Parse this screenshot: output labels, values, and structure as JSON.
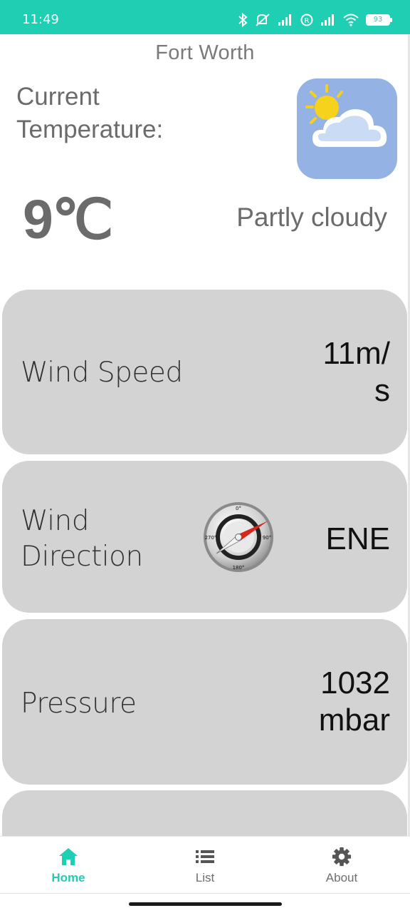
{
  "status_bar": {
    "time": "11:49",
    "battery": "93",
    "icons": [
      "bluetooth-icon",
      "mute-vibrate-icon",
      "signal-icon",
      "roaming-icon",
      "signal-icon",
      "wifi-icon",
      "battery-icon"
    ]
  },
  "header": {
    "city": "Fort Worth"
  },
  "current": {
    "label": "Current Temperature:",
    "temperature": "9℃",
    "condition": "Partly cloudy",
    "icon": "partly-cloudy-icon"
  },
  "cards": {
    "wind_speed": {
      "label": "Wind Speed",
      "value_line1": "11m/",
      "value_line2": "s"
    },
    "wind_direction": {
      "label_line1": "Wind",
      "label_line2": "Direction",
      "value": "ENE",
      "icon": "compass-icon",
      "compass_marks": [
        "0°",
        "90°",
        "180°",
        "270°"
      ]
    },
    "pressure": {
      "label": "Pressure",
      "value_line1": "1032",
      "value_line2": "mbar"
    }
  },
  "nav": {
    "items": [
      {
        "label": "Home",
        "icon": "home-icon",
        "active": true
      },
      {
        "label": "List",
        "icon": "list-icon",
        "active": false
      },
      {
        "label": "About",
        "icon": "gear-icon",
        "active": false
      }
    ]
  },
  "colors": {
    "accent": "#1ecfb3",
    "card_bg": "#d3d3d3",
    "icon_bg": "#95b2e4",
    "text_muted": "#6b6b6b"
  }
}
